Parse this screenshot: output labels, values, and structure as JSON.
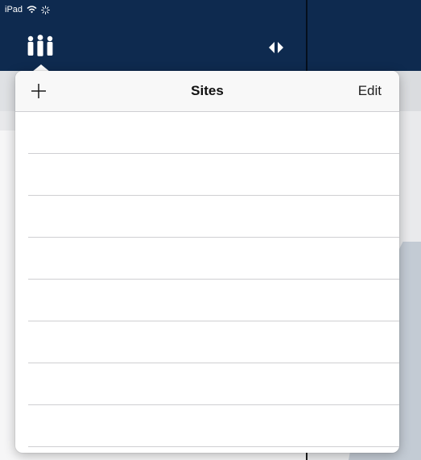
{
  "status_bar": {
    "device_label": "iPad",
    "icons": [
      "wifi-icon",
      "activity-spinner-icon"
    ]
  },
  "toolbar": {
    "left_icon": "people-icon",
    "right_icon": "split-view-toggle-icon"
  },
  "sites_popover": {
    "add_icon": "plus-icon",
    "title": "Sites",
    "edit_label": "Edit",
    "items": [
      {
        "label": ""
      },
      {
        "label": ""
      },
      {
        "label": ""
      },
      {
        "label": ""
      },
      {
        "label": ""
      },
      {
        "label": ""
      },
      {
        "label": ""
      },
      {
        "label": ""
      }
    ]
  },
  "colors": {
    "toolbar_background": "#0e2a4f",
    "popover_background": "#ffffff",
    "separator": "#cfcfd2",
    "text": "#111111"
  }
}
